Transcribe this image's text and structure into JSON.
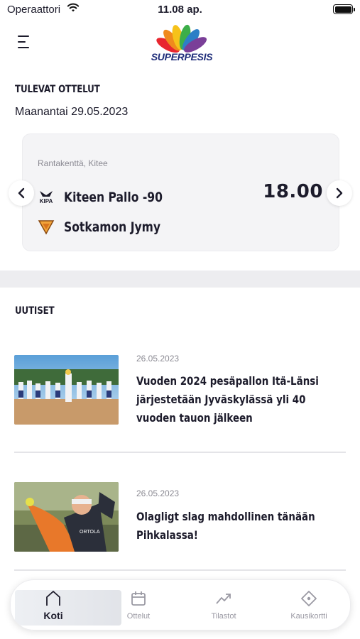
{
  "status_bar": {
    "carrier": "Operaattori",
    "time": "11.08 ap."
  },
  "header": {
    "logo_text": "SUPERPESIS"
  },
  "upcoming": {
    "section_title": "TULEVAT OTTELUT",
    "date": "Maanantai 29.05.2023",
    "match": {
      "venue": "Rantakenttä, Kitee",
      "home_team": "Kiteen Pallo -90",
      "home_logo_text": "KIPA",
      "away_team": "Sotkamon Jymy",
      "time": "18.00"
    }
  },
  "news": {
    "section_title": "UUTISET",
    "items": [
      {
        "date": "26.05.2023",
        "headline": "Vuoden 2024 pesäpallon Itä-Länsi järjestetään Jyväskylässä yli 40 vuoden tauon jälkeen"
      },
      {
        "date": "26.05.2023",
        "headline": "Olagligt slag mahdollinen tänään Pihkalassa!"
      }
    ]
  },
  "tab_bar": {
    "tabs": [
      {
        "label": "Koti",
        "icon": "home-icon",
        "active": true
      },
      {
        "label": "Ottelut",
        "icon": "calendar-icon",
        "active": false
      },
      {
        "label": "Tilastot",
        "icon": "trend-icon",
        "active": false
      },
      {
        "label": "Kausikortti",
        "icon": "ticket-icon",
        "active": false
      }
    ]
  },
  "colors": {
    "text": "#1c1b2b",
    "muted": "#8b8a93",
    "card": "#f4f4f6",
    "band": "#ededf0"
  }
}
